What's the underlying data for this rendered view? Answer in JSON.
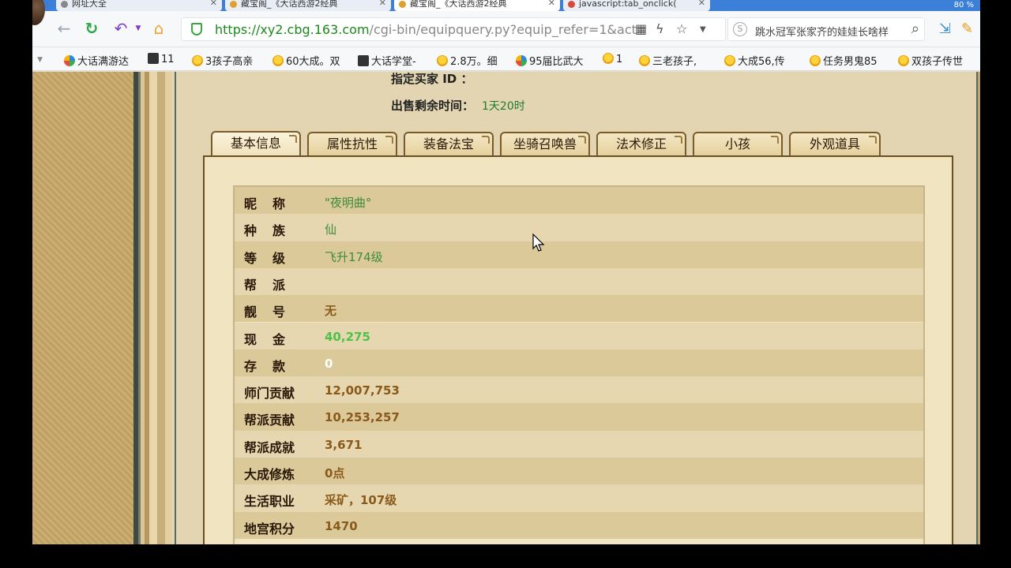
{
  "browser": {
    "tabs": [
      {
        "title": "网址大全"
      },
      {
        "title": "藏宝阁_《大话西游2经典"
      },
      {
        "title": "藏宝阁_《大话西游2经典"
      },
      {
        "title": "javascript:tab_onclick("
      }
    ],
    "tabstrip_right": "80 %",
    "url_host": "https://xy2.cbg.163.com",
    "url_path": "/cgi-bin/equipquery.py?equip_refer=1&act=",
    "search_text": "跳水冠军张家齐的娃娃长啥样"
  },
  "bookmarks": [
    {
      "label": "大话满游达",
      "icon": "blue"
    },
    {
      "label": "11",
      "icon": "dark"
    },
    {
      "label": "3孩子高亲",
      "icon": "chick"
    },
    {
      "label": "60大成。双",
      "icon": "chick"
    },
    {
      "label": "大话学堂-",
      "icon": "dark"
    },
    {
      "label": "2.8万。细",
      "icon": "chick"
    },
    {
      "label": "95届比武大",
      "icon": "blue"
    },
    {
      "label": "1",
      "icon": "chick"
    },
    {
      "label": "三老孩子,",
      "icon": "chick"
    },
    {
      "label": "大成56,传",
      "icon": "chick"
    },
    {
      "label": "任务男鬼85",
      "icon": "chick"
    },
    {
      "label": "双孩子传世",
      "icon": "chick"
    }
  ],
  "header_info": {
    "seller_id_label": "指定买家 ID  ：",
    "time_left_label": "出售剩余时间：",
    "time_left_value": "1天20时"
  },
  "tabs": [
    {
      "label": "基本信息"
    },
    {
      "label": "属性抗性"
    },
    {
      "label": "装备法宝"
    },
    {
      "label": "坐骑召唤兽"
    },
    {
      "label": "法术修正"
    },
    {
      "label": "小孩"
    },
    {
      "label": "外观道具"
    }
  ],
  "rows": [
    {
      "label": "昵称",
      "value": "\"夜明曲°",
      "style": "green",
      "spread": true
    },
    {
      "label": "种族",
      "value": "仙",
      "style": "green",
      "spread": true
    },
    {
      "label": "等级",
      "value": "飞升174级",
      "style": "green",
      "spread": true
    },
    {
      "label": "帮派",
      "value": "",
      "style": "green",
      "spread": true
    },
    {
      "label": "靓号",
      "value": "无",
      "style": "brown",
      "spread": true
    },
    {
      "label": "现金",
      "value": "40,275",
      "style": "money",
      "spread": true
    },
    {
      "label": "存款",
      "value": "0",
      "style": "white",
      "spread": true
    },
    {
      "label": "师门贡献",
      "value": "12,007,753",
      "style": "brown",
      "spread": false
    },
    {
      "label": "帮派贡献",
      "value": "10,253,257",
      "style": "brown",
      "spread": false
    },
    {
      "label": "帮派成就",
      "value": "3,671",
      "style": "brown",
      "spread": false
    },
    {
      "label": "大成修炼",
      "value": "0点",
      "style": "brown",
      "spread": false
    },
    {
      "label": "生活职业",
      "value": "采矿，107级",
      "style": "brown",
      "spread": false
    },
    {
      "label": "地宫积分",
      "value": "1470",
      "style": "brown",
      "spread": false
    }
  ]
}
